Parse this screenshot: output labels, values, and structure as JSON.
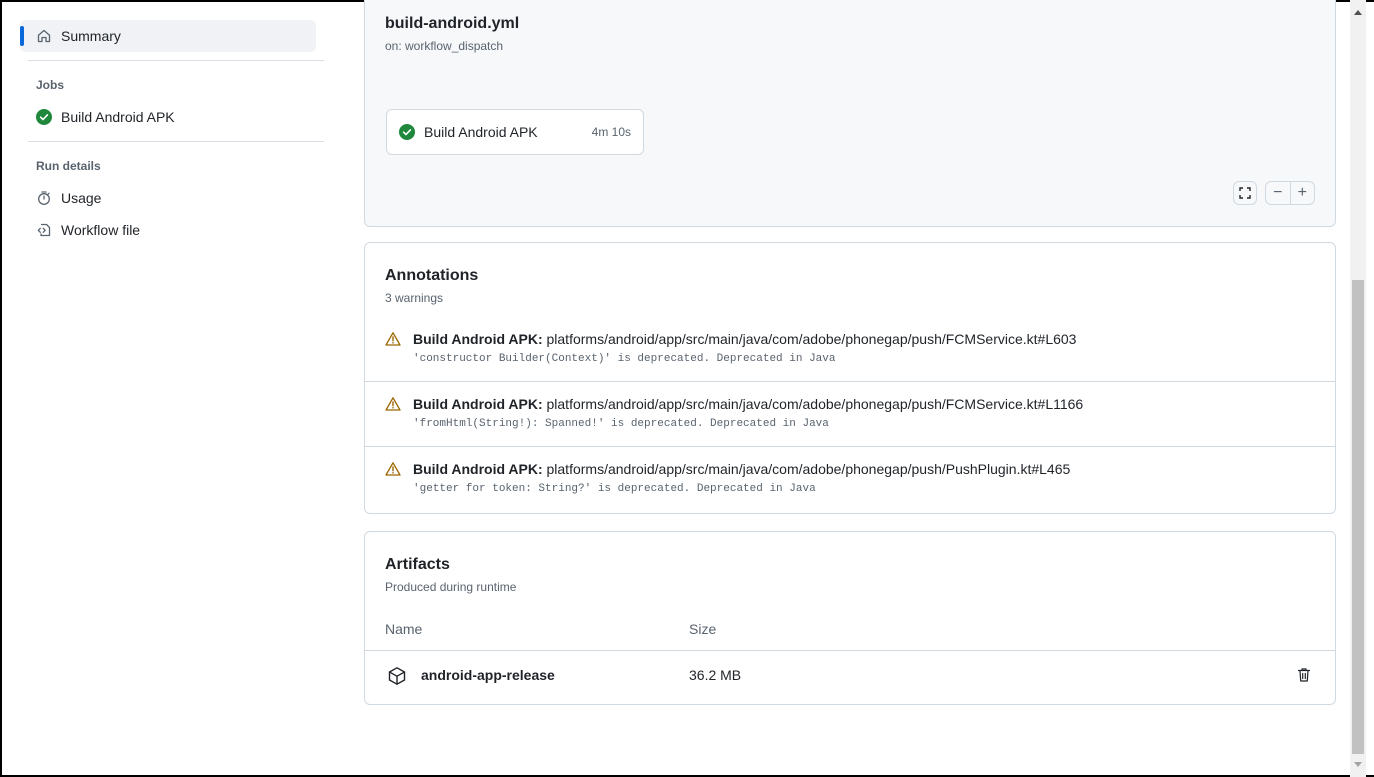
{
  "sidebar": {
    "summary_label": "Summary",
    "jobs_heading": "Jobs",
    "job_label": "Build Android APK",
    "run_details_heading": "Run details",
    "usage_label": "Usage",
    "workflow_file_label": "Workflow file"
  },
  "graph": {
    "title": "build-android.yml",
    "trigger": "on: workflow_dispatch",
    "job_name": "Build Android APK",
    "job_duration": "4m 10s"
  },
  "annotations": {
    "title": "Annotations",
    "subtitle": "3 warnings",
    "items": [
      {
        "job": "Build Android APK:",
        "path": "platforms/android/app/src/main/java/com/adobe/phonegap/push/FCMService.kt#L603",
        "message": "'constructor Builder(Context)' is deprecated. Deprecated in Java"
      },
      {
        "job": "Build Android APK:",
        "path": "platforms/android/app/src/main/java/com/adobe/phonegap/push/FCMService.kt#L1166",
        "message": "'fromHtml(String!): Spanned!' is deprecated. Deprecated in Java"
      },
      {
        "job": "Build Android APK:",
        "path": "platforms/android/app/src/main/java/com/adobe/phonegap/push/PushPlugin.kt#L465",
        "message": "'getter for token: String?' is deprecated. Deprecated in Java"
      }
    ]
  },
  "artifacts": {
    "title": "Artifacts",
    "subtitle": "Produced during runtime",
    "col_name": "Name",
    "col_size": "Size",
    "rows": [
      {
        "name": "android-app-release",
        "size": "36.2 MB"
      }
    ]
  },
  "colors": {
    "success": "#1f883d",
    "warning": "#9a6700",
    "accent": "#0969da"
  }
}
